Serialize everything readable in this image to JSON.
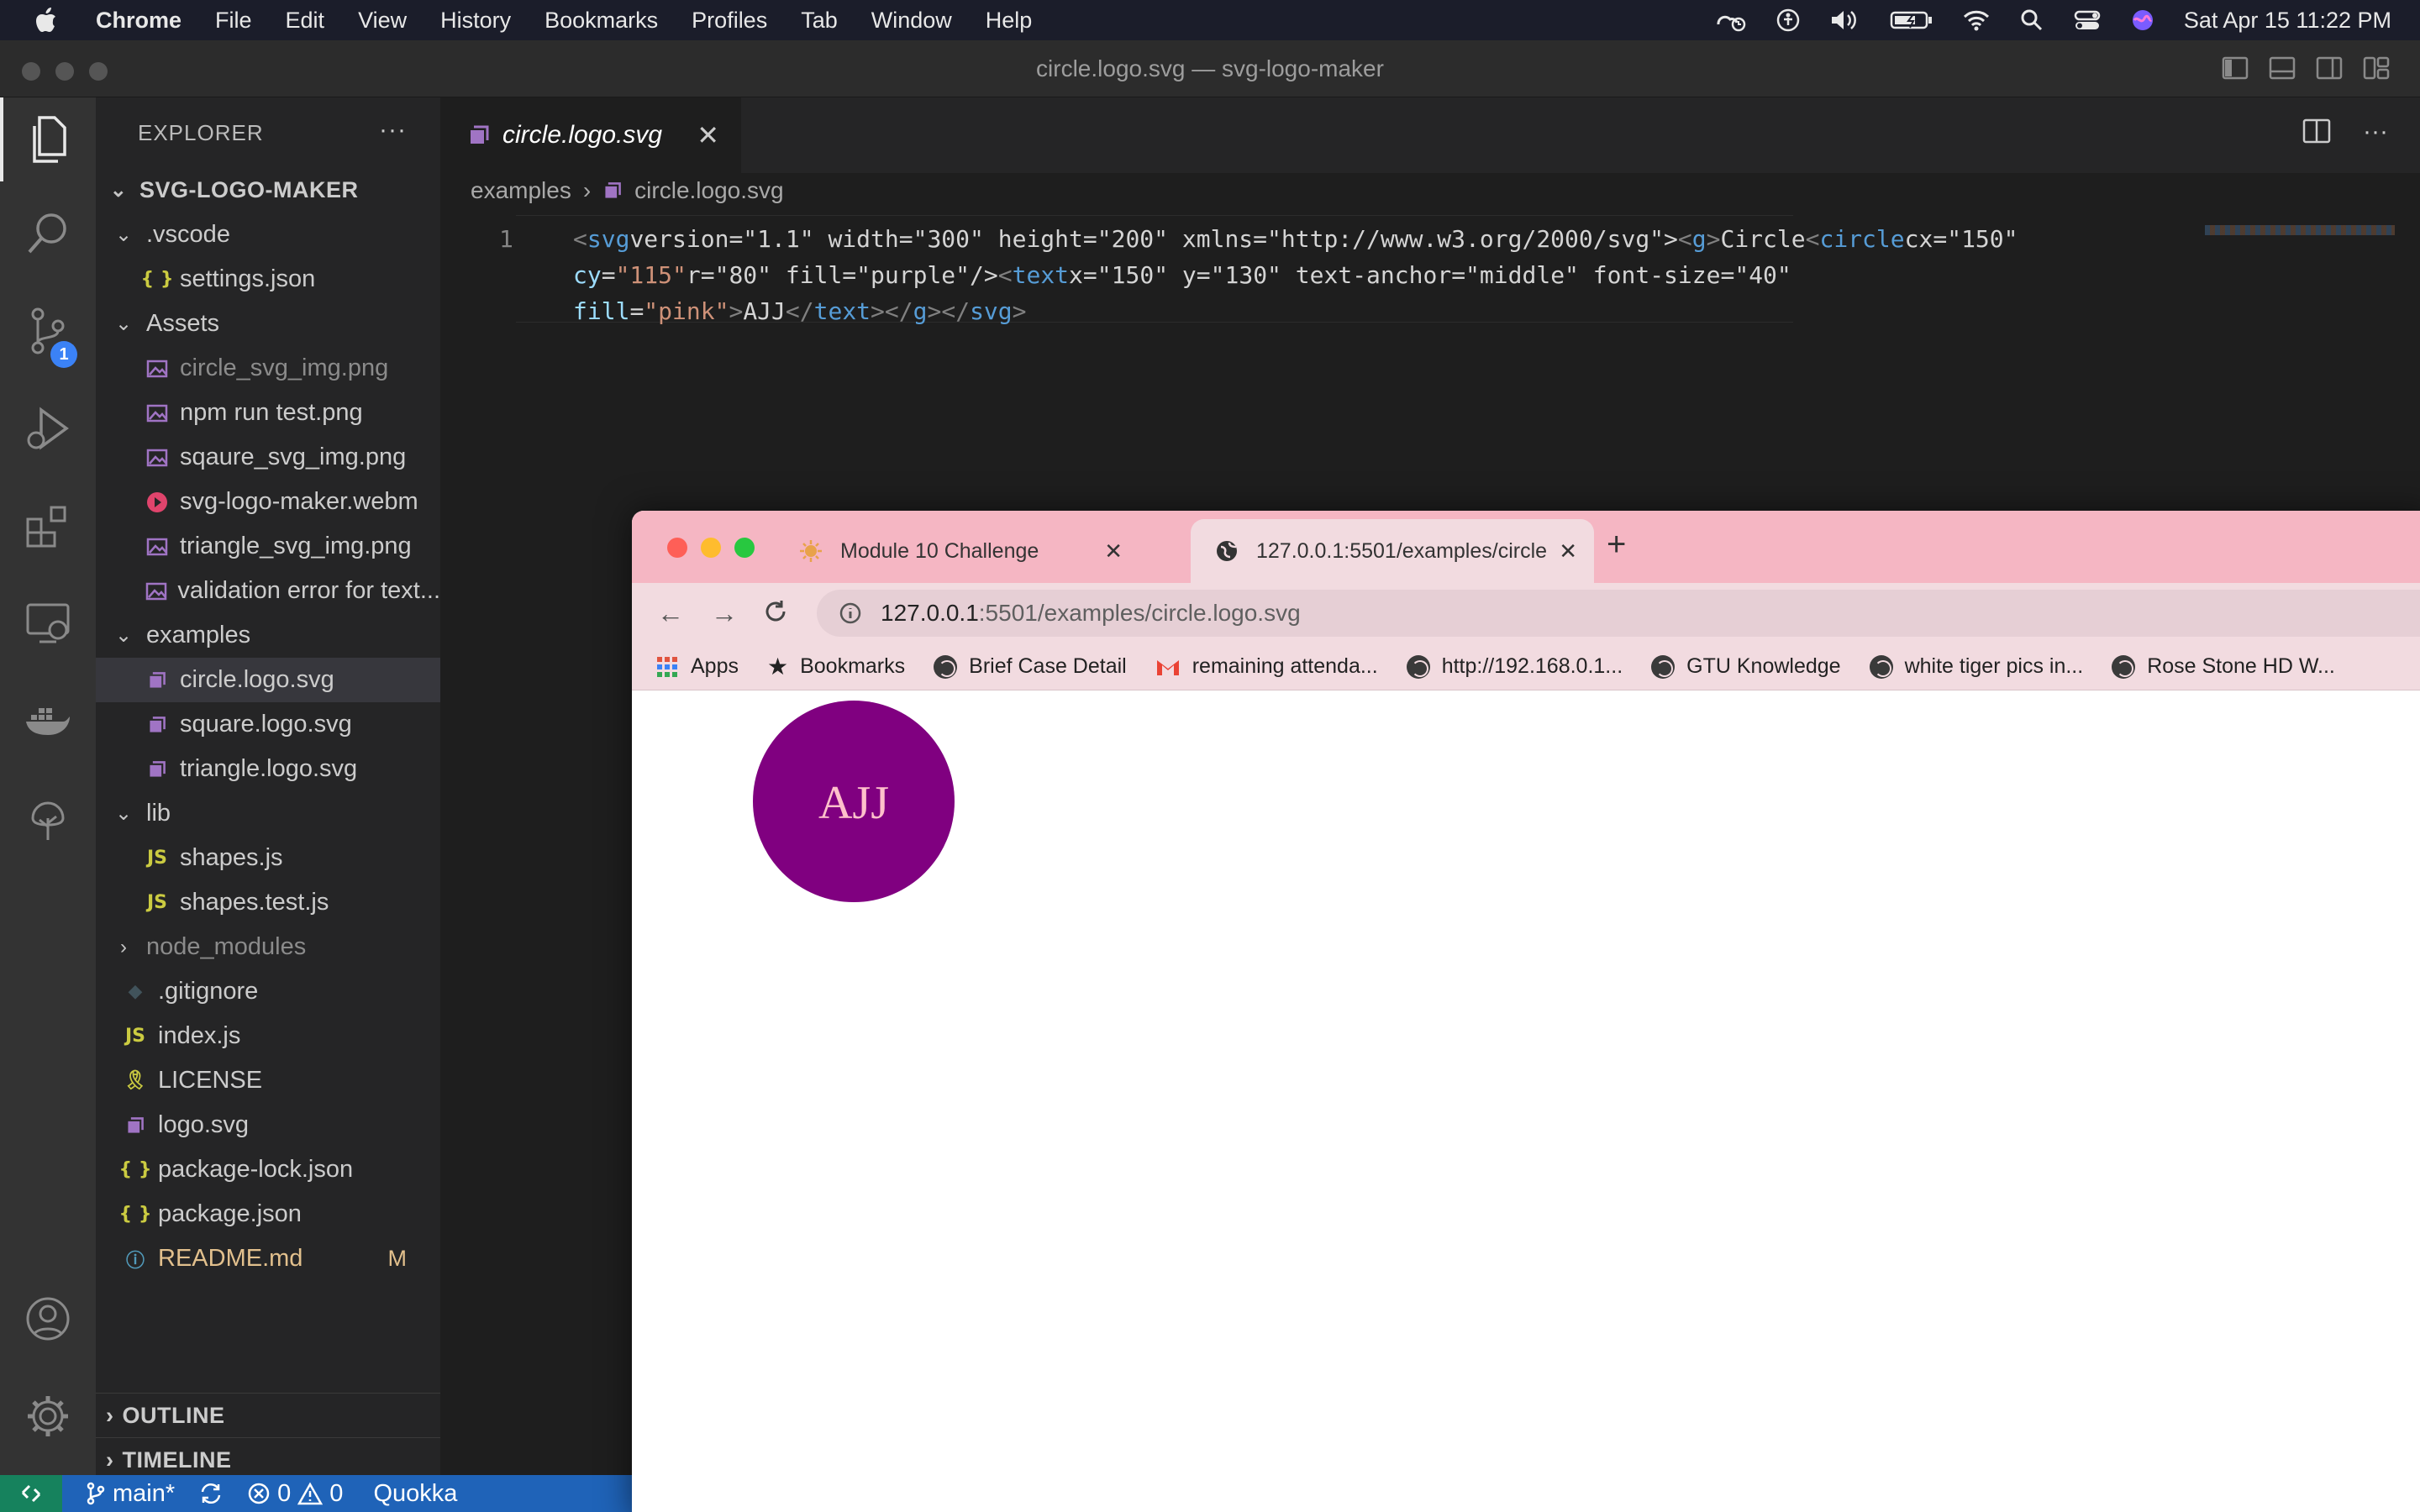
{
  "menubar": {
    "app": "Chrome",
    "items": [
      "File",
      "Edit",
      "View",
      "History",
      "Bookmarks",
      "Profiles",
      "Tab",
      "Window",
      "Help"
    ],
    "clock": "Sat Apr 15  11:22 PM"
  },
  "vscode": {
    "window_title": "circle.logo.svg — svg-logo-maker",
    "explorer_title": "EXPLORER",
    "project": "SVG-LOGO-MAKER",
    "scm_badge": "1",
    "tree": [
      {
        "label": ".vscode",
        "type": "folder-open",
        "depth": 1
      },
      {
        "label": "settings.json",
        "type": "json",
        "depth": 2
      },
      {
        "label": "Assets",
        "type": "folder-open",
        "depth": 1
      },
      {
        "label": "circle_svg_img.png",
        "type": "image",
        "depth": 2,
        "dim": true
      },
      {
        "label": "npm run test.png",
        "type": "image",
        "depth": 2
      },
      {
        "label": "sqaure_svg_img.png",
        "type": "image",
        "depth": 2
      },
      {
        "label": "svg-logo-maker.webm",
        "type": "video",
        "depth": 2
      },
      {
        "label": "triangle_svg_img.png",
        "type": "image",
        "depth": 2
      },
      {
        "label": "validation error for text...",
        "type": "image",
        "depth": 2
      },
      {
        "label": "examples",
        "type": "folder-open",
        "depth": 1
      },
      {
        "label": "circle.logo.svg",
        "type": "svg",
        "depth": 2,
        "selected": true
      },
      {
        "label": "square.logo.svg",
        "type": "svg",
        "depth": 2
      },
      {
        "label": "triangle.logo.svg",
        "type": "svg",
        "depth": 2
      },
      {
        "label": "lib",
        "type": "folder-open",
        "depth": 1
      },
      {
        "label": "shapes.js",
        "type": "js",
        "depth": 2
      },
      {
        "label": "shapes.test.js",
        "type": "js",
        "depth": 2
      },
      {
        "label": "node_modules",
        "type": "folder-closed",
        "depth": 1,
        "dim": true
      },
      {
        "label": ".gitignore",
        "type": "git",
        "depth": 1
      },
      {
        "label": "index.js",
        "type": "js",
        "depth": 1
      },
      {
        "label": "LICENSE",
        "type": "license",
        "depth": 1
      },
      {
        "label": "logo.svg",
        "type": "svg",
        "depth": 1
      },
      {
        "label": "package-lock.json",
        "type": "json",
        "depth": 1
      },
      {
        "label": "package.json",
        "type": "json",
        "depth": 1
      },
      {
        "label": "README.md",
        "type": "info",
        "depth": 1,
        "modified": true,
        "mark": "M"
      }
    ],
    "outline_label": "OUTLINE",
    "timeline_label": "TIMELINE",
    "tab_label": "circle.logo.svg",
    "breadcrumb": [
      "examples",
      "circle.logo.svg"
    ],
    "line_number": "1",
    "code_lines": [
      "<svg version=\"1.1\" width=\"300\" height=\"200\" xmlns=\"http://www.w3.org/2000/svg\"><g>Circle<circle cx=\"150\"",
      "cy=\"115\" r=\"80\" fill=\"purple\"/><text x=\"150\" y=\"130\" text-anchor=\"middle\" font-size=\"40\"",
      "fill=\"pink\">AJJ</text></g></svg>"
    ],
    "status": {
      "branch": "main*",
      "errors": "0",
      "warnings": "0",
      "extension": "Quokka"
    }
  },
  "chrome": {
    "tabs": [
      {
        "label": "Module 10 Challenge",
        "active": false
      },
      {
        "label": "127.0.0.1:5501/examples/circle",
        "active": true
      }
    ],
    "url_host": "127.0.0.1",
    "url_path": ":5501/examples/circle.logo.svg",
    "bookmarks": [
      "Apps",
      "Bookmarks",
      "Brief Case Detail",
      "remaining attenda...",
      "http://192.168.0.1...",
      "GTU Knowledge",
      "white tiger pics in...",
      "Rose Stone HD W..."
    ],
    "logo": {
      "text": "AJJ",
      "circle_fill": "#800080",
      "text_fill": "#ffc0cb"
    }
  },
  "colors": {
    "statusbar": "#1f63b8",
    "chrome_tabstrip": "#f5b6c3",
    "svg_icon": "#a074c4",
    "js_icon": "#cbcb41",
    "json_icon": "#cbcb41"
  }
}
